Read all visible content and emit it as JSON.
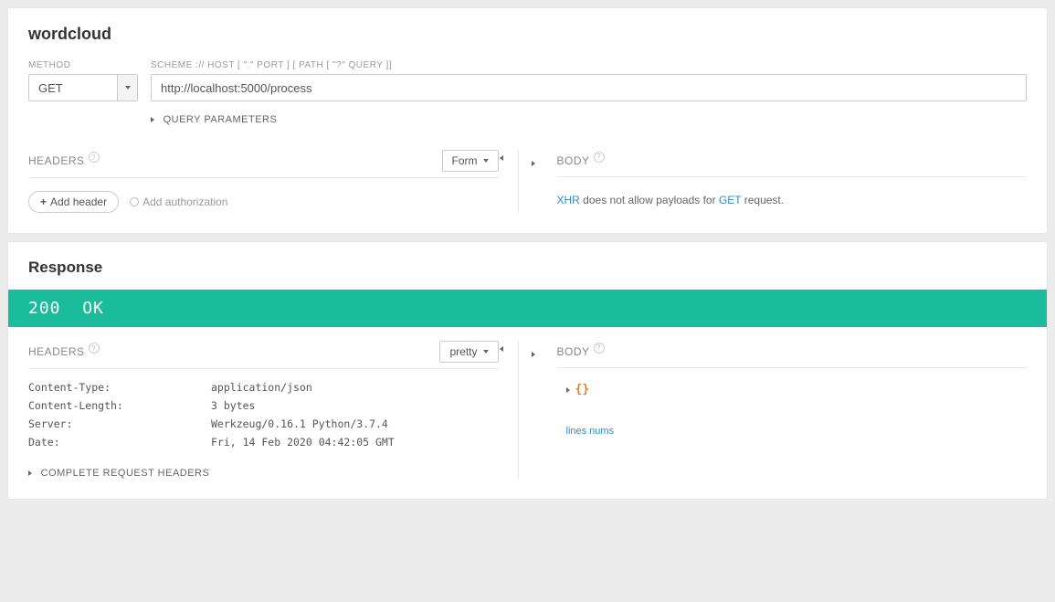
{
  "request": {
    "title": "wordcloud",
    "method_label": "METHOD",
    "method_value": "GET",
    "url_label": "SCHEME :// HOST [ \":\" PORT ] [ PATH [ \"?\" QUERY ]]",
    "url_value": "http://localhost:5000/process",
    "query_params_label": "QUERY PARAMETERS",
    "headers_label": "HEADERS",
    "form_select_label": "Form",
    "add_header_label": "Add header",
    "add_auth_label": "Add authorization",
    "body_label": "BODY",
    "body_msg_prefix": "XHR",
    "body_msg_mid": " does not allow payloads for ",
    "body_msg_method": "GET",
    "body_msg_suffix": " request."
  },
  "response": {
    "title": "Response",
    "status_code": "200",
    "status_text": "OK",
    "headers_label": "HEADERS",
    "pretty_label": "pretty",
    "body_label": "BODY",
    "headers": [
      {
        "key": "Content-Type:",
        "value": "application/json"
      },
      {
        "key": "Content-Length:",
        "value": "3 bytes"
      },
      {
        "key": "Server:",
        "value": "Werkzeug/0.16.1 Python/3.7.4"
      },
      {
        "key": "Date:",
        "value": "Fri, 14 Feb 2020 04:42:05 GMT"
      }
    ],
    "complete_headers_label": "COMPLETE REQUEST HEADERS",
    "json_brace": "{}",
    "lines_nums_label": "lines nums"
  }
}
